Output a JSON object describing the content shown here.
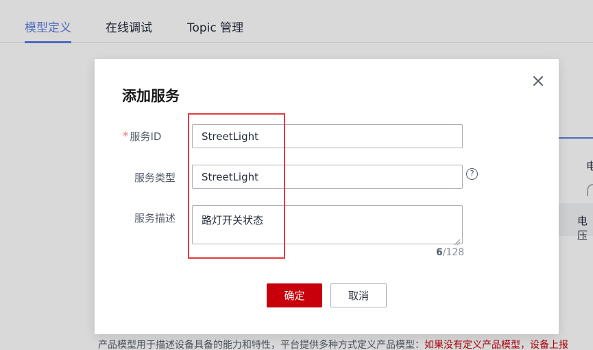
{
  "tabs": [
    "模型定义",
    "在线调试",
    "Topic 管理"
  ],
  "active_tab_index": 0,
  "background": {
    "right_label_1": "电",
    "right_label_2": "电压",
    "description_text": "产品模型用于描述设备具备的能力和特性，平台提供多种方式定义产品模型：",
    "description_link": "如果没有定义产品模型，设备上报"
  },
  "modal": {
    "title": "添加服务",
    "fields": {
      "service_id": {
        "label": "服务ID",
        "required_mark": "*",
        "value": "StreetLight"
      },
      "service_type": {
        "label": "服务类型",
        "value": "StreetLight",
        "help_icon": "?"
      },
      "service_desc": {
        "label": "服务描述",
        "value": "路灯开关状态",
        "count": "6",
        "max": "/128"
      }
    },
    "confirm_label": "确定",
    "cancel_label": "取消"
  },
  "colors": {
    "accent": "#5e7ce0",
    "primary_button": "#c7000b",
    "highlight_box": "#e4393c",
    "link": "#c7000b"
  }
}
